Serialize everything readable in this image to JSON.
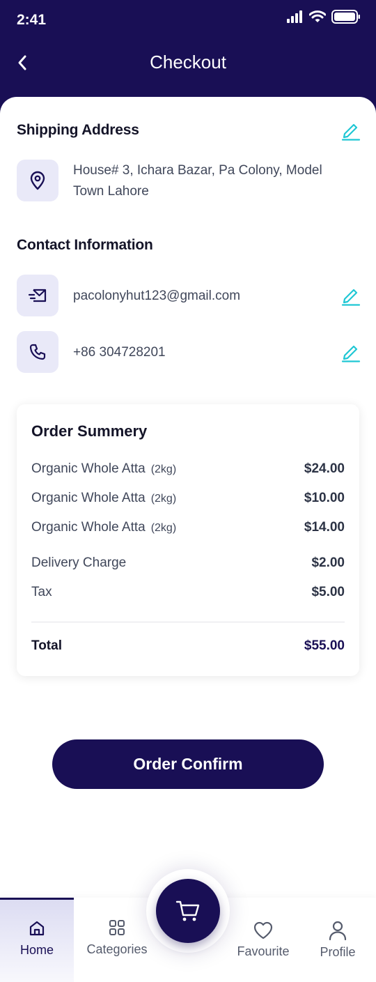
{
  "status_bar": {
    "time": "2:41"
  },
  "header": {
    "title": "Checkout"
  },
  "shipping": {
    "title": "Shipping Address",
    "address_line1": "House# 3, Ichara Bazar, Pa Colony, Model",
    "address_line2": "Town Lahore"
  },
  "contact": {
    "title": "Contact Information",
    "email": "pacolonyhut123@gmail.com",
    "phone": "+86 304728201"
  },
  "order_summary": {
    "title": "Order Summery",
    "items": [
      {
        "name": "Organic Whole Atta",
        "qty": "(2kg)",
        "price": "$24.00"
      },
      {
        "name": "Organic Whole Atta",
        "qty": "(2kg)",
        "price": "$10.00"
      },
      {
        "name": "Organic Whole Atta",
        "qty": "(2kg)",
        "price": "$14.00"
      }
    ],
    "delivery_label": "Delivery Charge",
    "delivery_value": "$2.00",
    "tax_label": "Tax",
    "tax_value": "$5.00",
    "total_label": "Total",
    "total_value": "$55.00"
  },
  "confirm_button": "Order Confirm",
  "nav": {
    "home": "Home",
    "categories": "Categories",
    "favourite": "Favourite",
    "profile": "Profile"
  },
  "colors": {
    "primary": "#190f55",
    "accent": "#1fc7d4",
    "icon_bg": "#e9e9f8"
  }
}
